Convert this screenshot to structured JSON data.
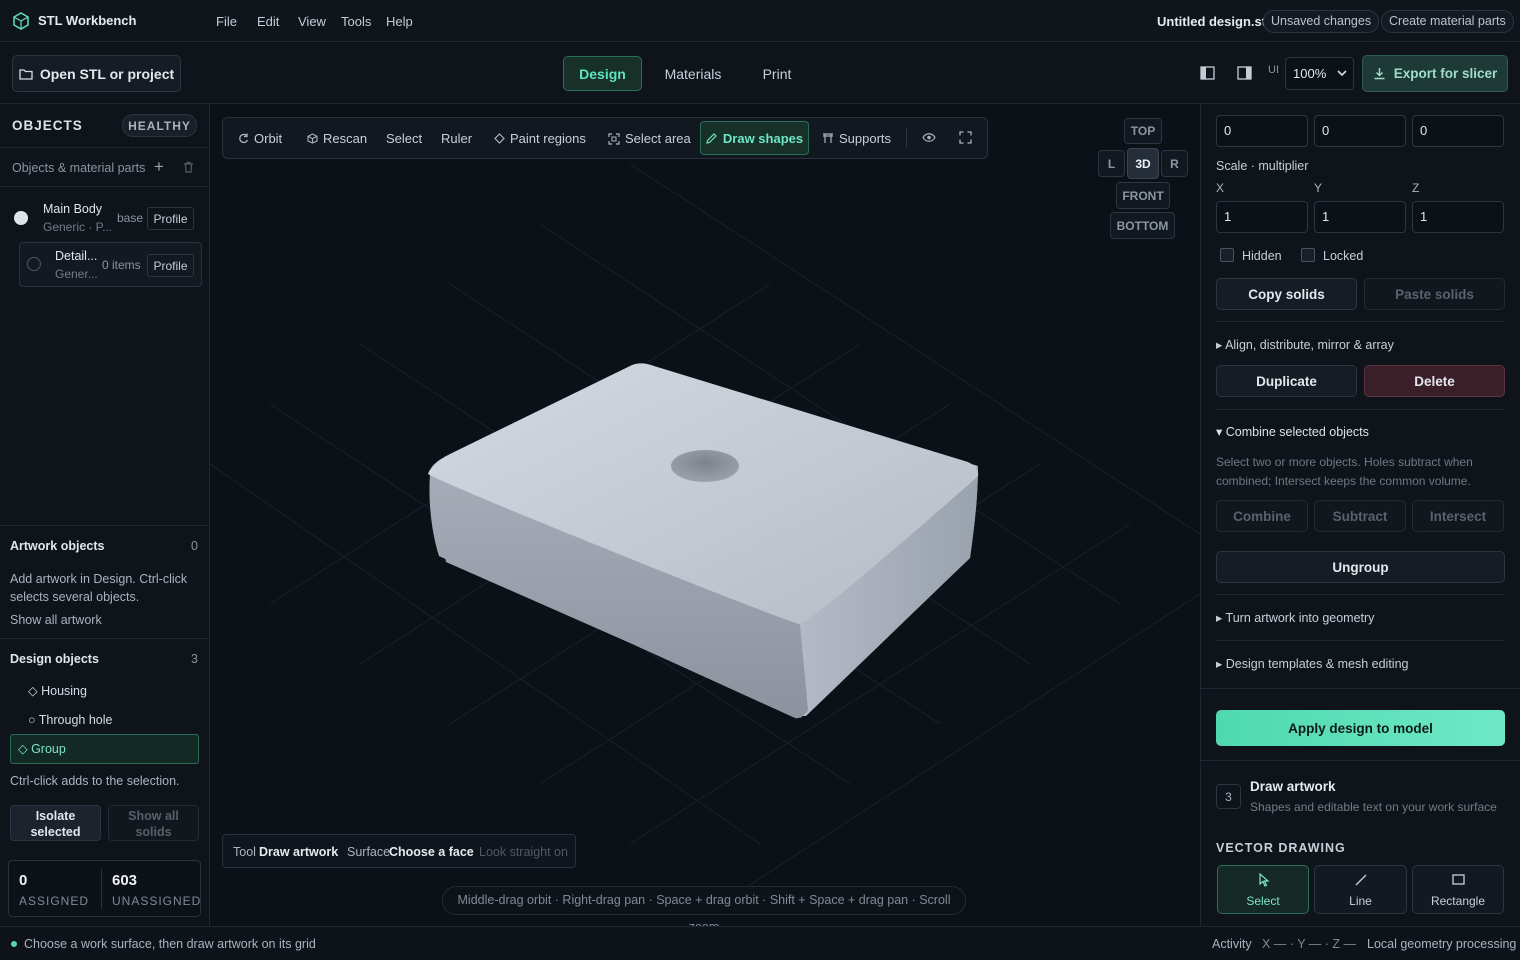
{
  "app": {
    "title": "STL Workbench",
    "menu": [
      "File",
      "Edit",
      "View",
      "Tools",
      "Help"
    ]
  },
  "header": {
    "document": "Untitled design.stl",
    "unsaved": "Unsaved changes",
    "create_parts": "Create material parts"
  },
  "toolbar": {
    "open": "Open STL or project",
    "tabs": [
      "Design",
      "Materials",
      "Print"
    ],
    "ui_label": "UI",
    "zoom": "100%",
    "export": "Export for slicer"
  },
  "left": {
    "objects_title": "OBJECTS",
    "health": "HEALTHY",
    "parts_label": "Objects & material parts",
    "items": [
      {
        "name": "Main Body",
        "sub": "Generic · P...",
        "tag": "base",
        "profile": "Profile"
      },
      {
        "name": "Detail...",
        "sub": "Gener...",
        "tag": "0 items",
        "profile": "Profile"
      }
    ],
    "artwork_title": "Artwork objects",
    "artwork_count": "0",
    "artwork_hint": "Add artwork in Design. Ctrl-click selects several objects.",
    "show_all_artwork": "Show all artwork",
    "design_title": "Design objects",
    "design_count": "3",
    "design_items": [
      "◇ Housing",
      "○ Through hole",
      "◇ Group"
    ],
    "ctrl_hint": "Ctrl-click adds to the selection.",
    "isolate": "Isolate selected",
    "show_solids": "Show all solids",
    "assigned_num": "0",
    "assigned_label": "ASSIGNED",
    "unassigned_num": "603",
    "unassigned_label": "UNASSIGNED"
  },
  "viewport": {
    "tools": [
      "Orbit",
      "Rescan",
      "Select",
      "Ruler",
      "Paint regions",
      "Select area",
      "Draw shapes",
      "Supports"
    ],
    "views": {
      "top": "TOP",
      "l": "L",
      "three_d": "3D",
      "r": "R",
      "front": "FRONT",
      "bottom": "BOTTOM"
    },
    "hud": {
      "tool_label": "Tool",
      "tool_value": "Draw artwork",
      "surface_label": "Surface",
      "surface_value": "Choose a face",
      "look": "Look straight on"
    },
    "hint": "Middle-drag orbit · Right-drag pan · Space + drag orbit · Shift + Space + drag pan · Scroll zoom"
  },
  "right": {
    "position": [
      "0",
      "0",
      "0"
    ],
    "scale_title": "Scale · multiplier",
    "axes": [
      "X",
      "Y",
      "Z"
    ],
    "scale": [
      "1",
      "1",
      "1"
    ],
    "hidden": "Hidden",
    "locked": "Locked",
    "copy": "Copy solids",
    "paste": "Paste solids",
    "align": "Align, distribute, mirror & array",
    "duplicate": "Duplicate",
    "delete": "Delete",
    "combine_title": "Combine selected objects",
    "combine_hint": "Select two or more objects. Holes subtract when combined; Intersect keeps the common volume.",
    "combine": "Combine",
    "subtract": "Subtract",
    "intersect": "Intersect",
    "ungroup": "Ungroup",
    "turn_geometry": "Turn artwork into geometry",
    "templates": "Design templates & mesh editing",
    "apply": "Apply design to model",
    "step_num": "3",
    "step_title": "Draw artwork",
    "step_sub": "Shapes and editable text on your work surface",
    "vector_title": "VECTOR DRAWING",
    "vector_tools": [
      "Select",
      "Line",
      "Rectangle"
    ]
  },
  "status": {
    "message": "Choose a work surface, then draw artwork on its grid",
    "activity": "Activity",
    "coords": "X — · Y — · Z —",
    "local": "Local geometry processing"
  },
  "colors": {
    "accent": "#5ee4bd",
    "apply": "#4fd8ae",
    "danger": "#3a1f29"
  }
}
